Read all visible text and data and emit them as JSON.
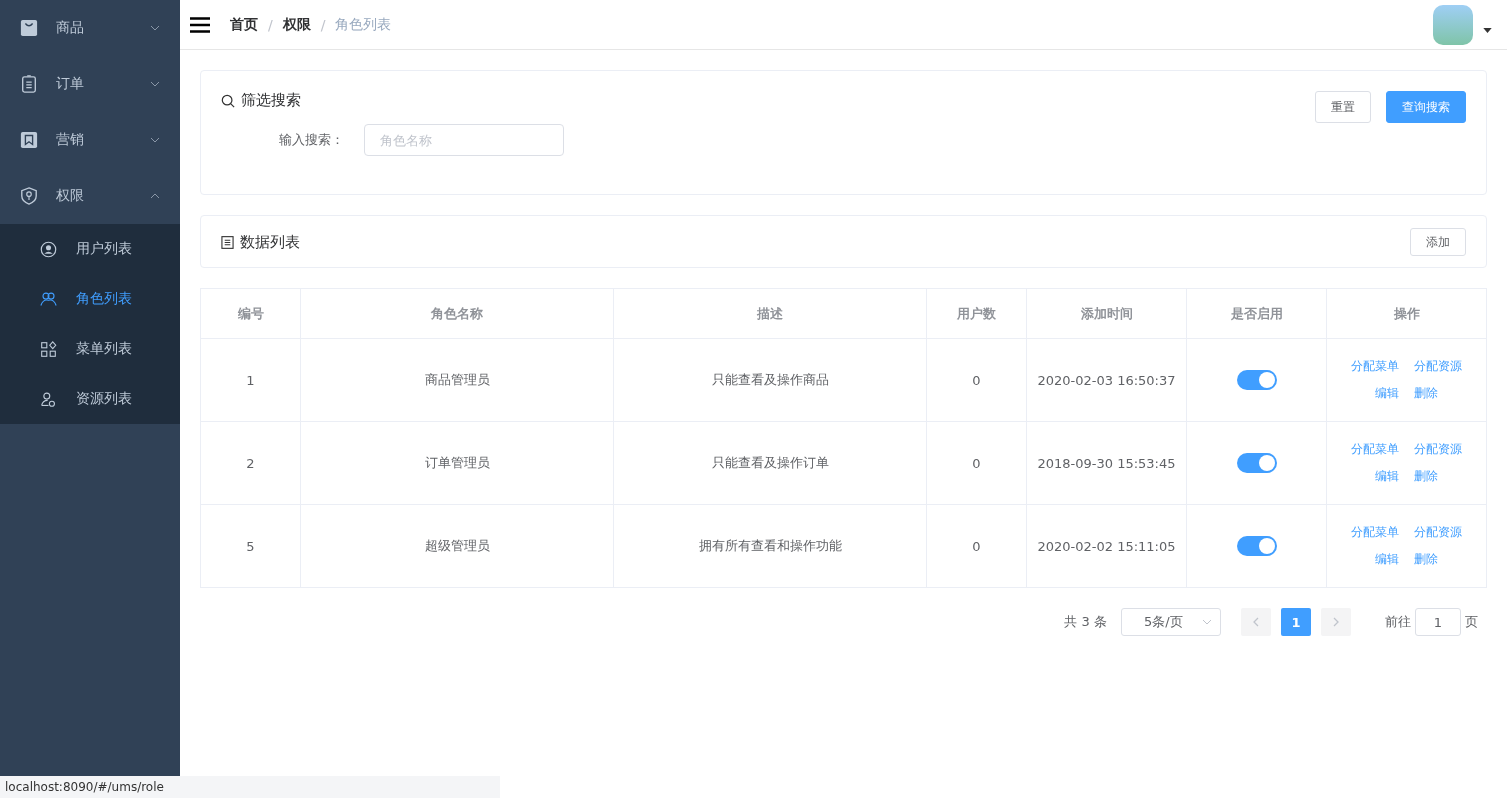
{
  "sidebar": {
    "items": [
      {
        "label": "商品",
        "kind": "bag",
        "expanded": false
      },
      {
        "label": "订单",
        "kind": "clipboard",
        "expanded": false
      },
      {
        "label": "营销",
        "kind": "bookmark",
        "expanded": false
      },
      {
        "label": "权限",
        "kind": "shield",
        "expanded": true,
        "children": [
          {
            "label": "用户列表",
            "kind": "user",
            "selected": false
          },
          {
            "label": "角色列表",
            "kind": "people",
            "selected": true
          },
          {
            "label": "菜单列表",
            "kind": "grid",
            "selected": false
          },
          {
            "label": "资源列表",
            "kind": "resource",
            "selected": false
          }
        ]
      }
    ]
  },
  "breadcrumb": [
    {
      "label": "首页",
      "current": false
    },
    {
      "label": "权限",
      "current": false
    },
    {
      "label": "角色列表",
      "current": true
    }
  ],
  "breadcrumb_separator": "/",
  "filter": {
    "title": "筛选搜索",
    "field_label": "输入搜索：",
    "placeholder": "角色名称",
    "buttons": [
      {
        "label": "重置",
        "kind": "plain"
      },
      {
        "label": "查询搜索",
        "kind": "primary"
      }
    ]
  },
  "list_header": {
    "title": "数据列表",
    "button": "添加"
  },
  "table": {
    "columns": [
      "编号",
      "角色名称",
      "描述",
      "用户数",
      "添加时间",
      "是否启用",
      "操作"
    ],
    "rows": [
      {
        "id": "1",
        "name": "商品管理员",
        "description": "只能查看及操作商品",
        "users": "0",
        "created": "2020-02-03 16:50:37",
        "enabled": true,
        "actions": [
          "分配菜单",
          "分配资源",
          "编辑",
          "删除"
        ]
      },
      {
        "id": "2",
        "name": "订单管理员",
        "description": "只能查看及操作订单",
        "users": "0",
        "created": "2018-09-30 15:53:45",
        "enabled": true,
        "actions": [
          "分配菜单",
          "分配资源",
          "编辑",
          "删除"
        ]
      },
      {
        "id": "5",
        "name": "超级管理员",
        "description": "拥有所有查看和操作功能",
        "users": "0",
        "created": "2020-02-02 15:11:05",
        "enabled": true,
        "actions": [
          "分配菜单",
          "分配资源",
          "编辑",
          "删除"
        ]
      }
    ]
  },
  "pagination": {
    "total": "共 3 条",
    "page_size": "5条/页",
    "pages": [
      {
        "label": "1",
        "selected": true
      }
    ],
    "goto_label": "前往",
    "goto_value": "1",
    "goto_suffix": "页"
  },
  "status_bar": "localhost:8090/#/ums/role"
}
